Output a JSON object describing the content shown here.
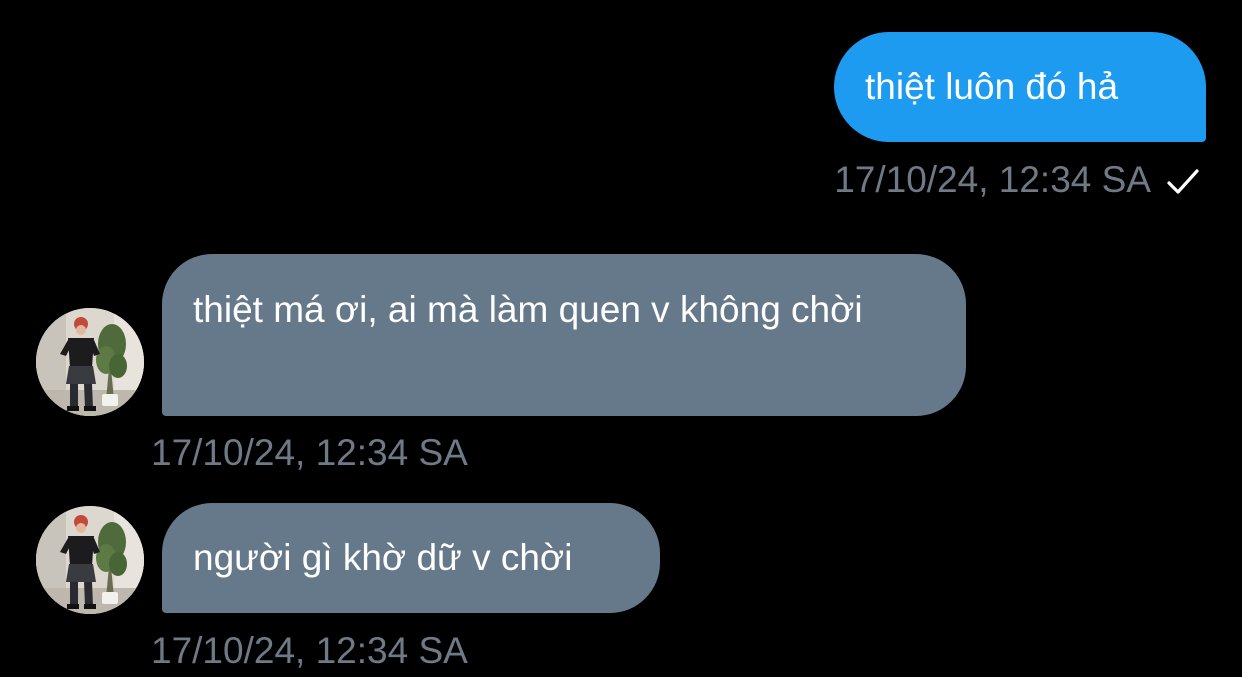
{
  "messages": [
    {
      "direction": "outgoing",
      "text": "thiệt luôn đó hả",
      "timestamp": "17/10/24, 12:34 SA",
      "status_icon": "checkmark-icon"
    },
    {
      "direction": "incoming",
      "text": "thiệt má ơi, ai mà làm quen v không chời",
      "timestamp": "17/10/24, 12:34 SA",
      "avatar_icon": "avatar"
    },
    {
      "direction": "incoming",
      "text": "người gì khờ dữ v chời",
      "timestamp": "17/10/24, 12:34 SA",
      "avatar_icon": "avatar"
    }
  ],
  "colors": {
    "background": "#000000",
    "outgoing_bubble": "#1d9bf0",
    "incoming_bubble": "#66798a",
    "timestamp_text": "#6e7a86",
    "message_text": "#ffffff"
  }
}
